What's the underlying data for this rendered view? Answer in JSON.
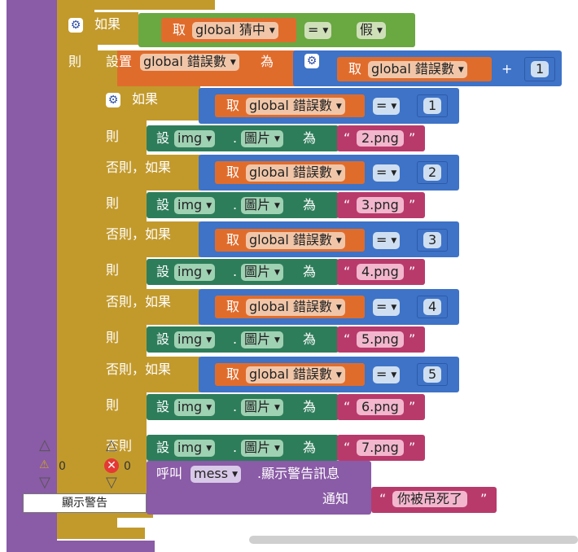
{
  "outer_if": {
    "label_if": "如果",
    "label_then": "則",
    "get": "取",
    "var": "global 猜中",
    "op": "=",
    "value": "假"
  },
  "set_stmt": {
    "label": "設置",
    "var": "global 錯誤數",
    "to": "為",
    "get": "取",
    "get_var": "global 錯誤數",
    "plus": "+",
    "num": "1"
  },
  "inner_if": {
    "label_if": "如果",
    "label_then": "則",
    "label_elseif": "否則，如果",
    "label_else": "否則",
    "get": "取",
    "var": "global 錯誤數",
    "op": "=",
    "set_label": "設",
    "component": "img",
    "dot": ".",
    "property": "圖片",
    "to": "為",
    "branches": [
      {
        "num": "1",
        "file": "2.png"
      },
      {
        "num": "2",
        "file": "3.png"
      },
      {
        "num": "3",
        "file": "4.png"
      },
      {
        "num": "4",
        "file": "5.png"
      },
      {
        "num": "5",
        "file": "6.png"
      }
    ],
    "else_file": "7.png"
  },
  "call_stmt": {
    "label": "呼叫",
    "component": "mess",
    "method": ".顯示警告訊息",
    "param": "通知",
    "message": "你被吊死了"
  },
  "warnings": {
    "warning_count": "0",
    "error_count": "0",
    "show_button": "顯示警告"
  }
}
